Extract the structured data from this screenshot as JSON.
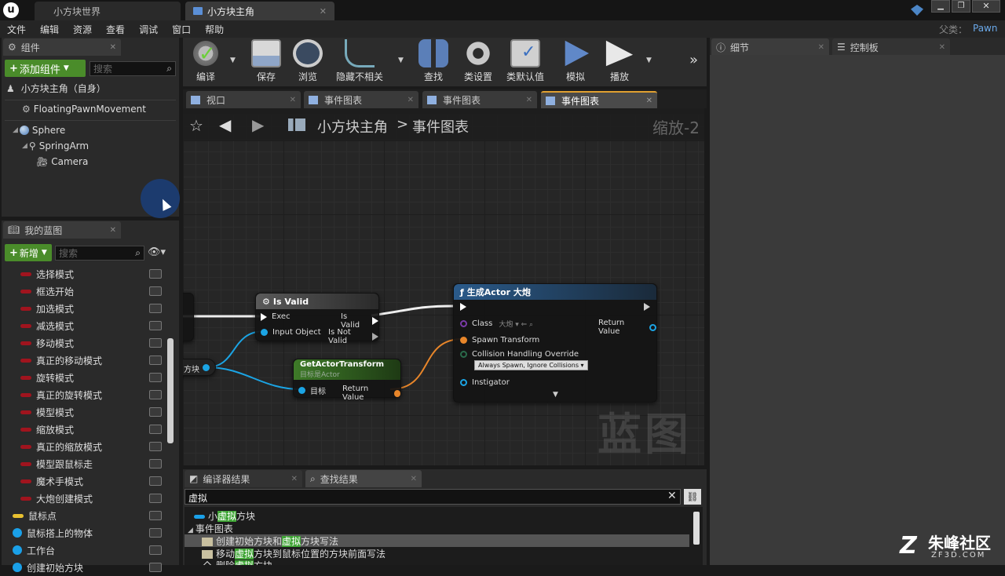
{
  "titlebar": {
    "tab_world": "小方块世界",
    "tab_actor": "小方块主角",
    "parent_label": "父类：",
    "parent_value": "Pawn"
  },
  "menu": [
    "文件",
    "编辑",
    "资源",
    "查看",
    "调试",
    "窗口",
    "帮助"
  ],
  "components": {
    "tab_title": "组件",
    "add_label": "添加组件",
    "search_placeholder": "搜索",
    "self_label": "小方块主角（自身）",
    "items": [
      "FloatingPawnMovement",
      "Sphere",
      "SpringArm",
      "Camera"
    ]
  },
  "my_blueprint": {
    "tab_title": "我的蓝图",
    "new_label": "新增",
    "search_placeholder": "搜索",
    "variables": [
      "选择模式",
      "框选开始",
      "加选模式",
      "减选模式",
      "移动模式",
      "真正的移动模式",
      "旋转模式",
      "真正的旋转模式",
      "模型模式",
      "缩放模式",
      "真正的缩放模式",
      "模型跟鼠标走",
      "魔术手模式",
      "大炮创建模式",
      "鼠标点",
      "鼠标搭上的物体",
      "工作台",
      "创建初始方块"
    ],
    "var_colors": [
      "#a0141e",
      "#a0141e",
      "#a0141e",
      "#a0141e",
      "#a0141e",
      "#a0141e",
      "#a0141e",
      "#a0141e",
      "#a0141e",
      "#a0141e",
      "#a0141e",
      "#a0141e",
      "#a0141e",
      "#a0141e",
      "#e8c030",
      "#1aa0e8",
      "#1aa0e8",
      "#1aa0e8"
    ]
  },
  "toolbar": {
    "items": [
      "编译",
      "保存",
      "浏览",
      "隐藏不相关",
      "查找",
      "类设置",
      "类默认值",
      "模拟",
      "播放"
    ]
  },
  "doc_tabs": [
    "视口",
    "事件图表",
    "事件图表",
    "事件图表"
  ],
  "breadcrumb": {
    "root": "小方块主角",
    "sep": ">",
    "current": "事件图表",
    "zoom": "缩放-2"
  },
  "graph": {
    "isvalid": {
      "title": "Is Valid",
      "exec": "Exec",
      "input": "Input Object",
      "valid": "Is Valid",
      "notvalid": "Is Not Valid"
    },
    "getxf": {
      "title": "GetActorTransform",
      "subtitle": "目标是Actor",
      "target": "目标",
      "ret": "Return Value"
    },
    "spawn": {
      "title": "生成Actor 大炮",
      "class": "Class",
      "class_val": "大炮",
      "ret": "Return Value",
      "transform": "Spawn Transform",
      "collision": "Collision Handling Override",
      "collision_val": "Always Spawn, Ignore Collisions",
      "instigator": "Instigator"
    },
    "var_node": "方块",
    "watermark": "蓝图"
  },
  "details": {
    "tab_details": "细节",
    "tab_palette": "控制板"
  },
  "results": {
    "tab_compiler": "编译器结果",
    "tab_find": "查找结果",
    "query": "虚拟",
    "lines": [
      {
        "pre": "小",
        "hl": "虚拟",
        "post": "方块"
      },
      {
        "pre": "事件图表",
        "hl": "",
        "post": ""
      },
      {
        "pre": "创建初始方块和",
        "hl": "虚拟",
        "post": "方块写法"
      },
      {
        "pre": "移动",
        "hl": "虚拟",
        "post": "方块到鼠标位置的方块前面写法"
      },
      {
        "pre": "删除",
        "hl": "虚拟",
        "post": "方块"
      }
    ]
  },
  "logo": {
    "brand": "朱峰社区",
    "url": "ZF3D.COM"
  }
}
